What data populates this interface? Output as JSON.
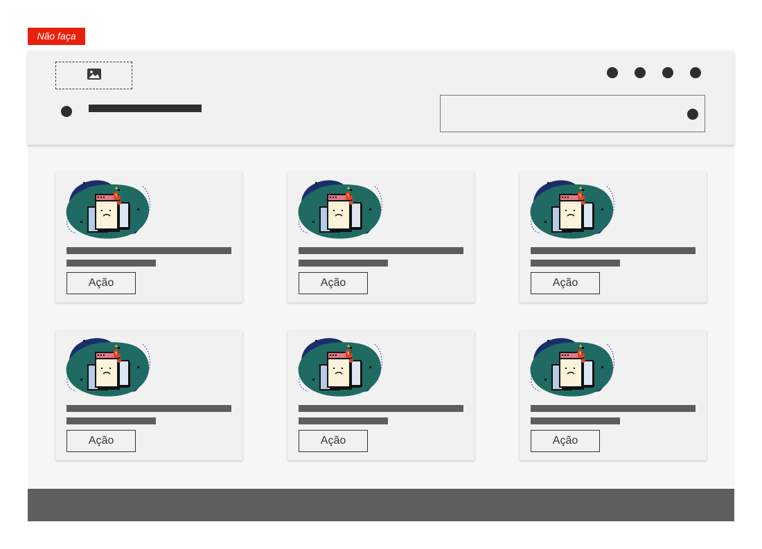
{
  "badge": {
    "label": "Não faça",
    "color": "#e8210d"
  },
  "header": {
    "logo_icon": "image-placeholder-icon",
    "nav_dots": [
      "nav-item",
      "nav-item",
      "nav-item",
      "nav-item"
    ],
    "menu_icon": "dot-icon",
    "search_icon": "dot-icon"
  },
  "cards": [
    {
      "illustration": "broken-browser-illustration",
      "action_label": "Ação"
    },
    {
      "illustration": "broken-browser-illustration",
      "action_label": "Ação"
    },
    {
      "illustration": "broken-browser-illustration",
      "action_label": "Ação"
    },
    {
      "illustration": "broken-browser-illustration",
      "action_label": "Ação"
    },
    {
      "illustration": "broken-browser-illustration",
      "action_label": "Ação"
    },
    {
      "illustration": "broken-browser-illustration",
      "action_label": "Ação"
    }
  ],
  "colors": {
    "header_bg": "#f2f1f2",
    "page_bg": "#f7f7f7",
    "footer_bg": "#5f5f5f",
    "text_placeholder": "#5d5d5d"
  }
}
